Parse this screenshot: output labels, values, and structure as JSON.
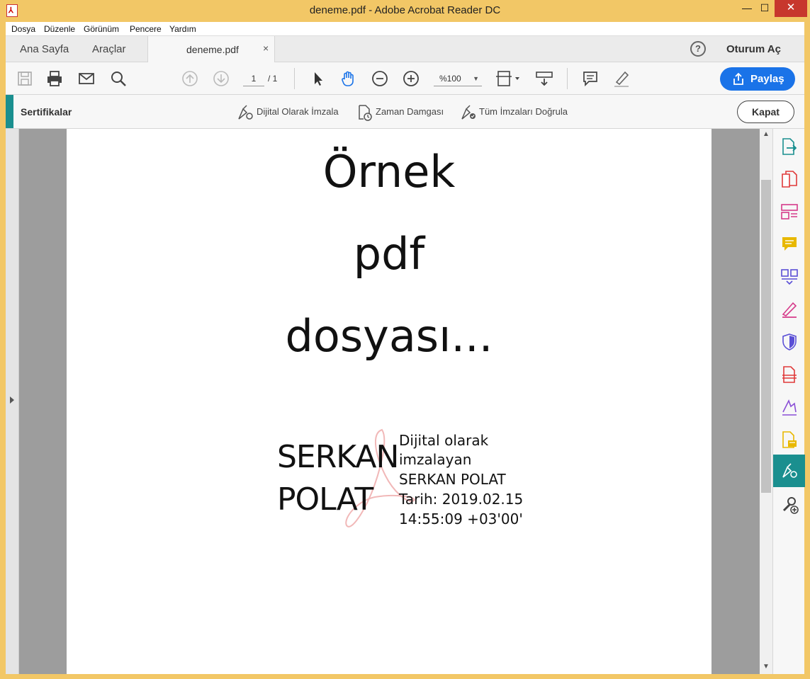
{
  "window": {
    "title": "deneme.pdf - Adobe Acrobat Reader DC",
    "min": "—",
    "max": "☐",
    "close": "✕"
  },
  "menu": [
    "Dosya",
    "Düzenle",
    "Görünüm",
    "Pencere",
    "Yardım"
  ],
  "tabs": {
    "home": "Ana Sayfa",
    "tools": "Araçlar",
    "document": "deneme.pdf",
    "close": "×"
  },
  "header": {
    "help": "?",
    "signin": "Oturum Aç"
  },
  "toolbar": {
    "page_current": "1",
    "page_total": "/ 1",
    "zoom": "%100",
    "share_label": "Paylaş"
  },
  "certificates": {
    "title": "Sertifikalar",
    "actions": [
      "Dijital Olarak İmzala",
      "Zaman Damgası",
      "Tüm İmzaları Doğrula"
    ],
    "close_label": "Kapat"
  },
  "document": {
    "lines": [
      "Örnek",
      "pdf",
      "dosyası..."
    ],
    "signature_name": [
      "SERKAN",
      "POLAT"
    ],
    "signature_info": [
      "Dijital olarak",
      "imzalayan",
      "SERKAN POLAT",
      "Tarih: 2019.02.15",
      "14:55:09 +03'00'"
    ]
  },
  "colors": {
    "accent": "#1a8f8f",
    "share": "#1a73e8",
    "titlebar": "#f2c766"
  }
}
